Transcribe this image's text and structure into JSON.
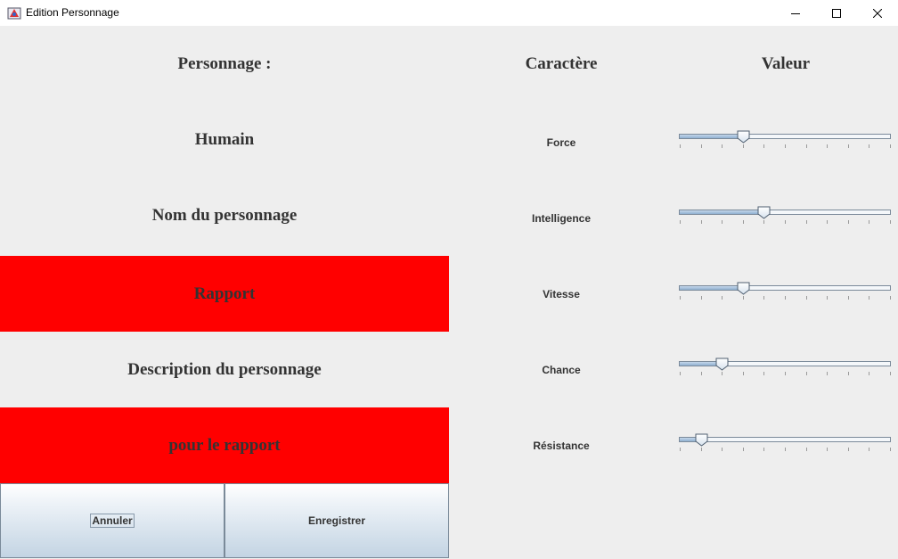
{
  "window": {
    "title": "Edition Personnage"
  },
  "left_panel": {
    "header": "Personnage :",
    "race": "Humain",
    "name_label": "Nom du personnage",
    "name_report": "Rapport",
    "description_label": "Description du personnage",
    "description_report": "pour le rapport",
    "report_color": "#ff0000"
  },
  "stats_panel": {
    "header_trait": "Caractère",
    "header_value": "Valeur",
    "traits": [
      {
        "label": "Force",
        "value": 30
      },
      {
        "label": "Intelligence",
        "value": 40
      },
      {
        "label": "Vitesse",
        "value": 30
      },
      {
        "label": "Chance",
        "value": 20
      },
      {
        "label": "Résistance",
        "value": 10
      }
    ],
    "slider_min": 0,
    "slider_max": 100,
    "tick_spacing": 10
  },
  "buttons": {
    "cancel": "Annuler",
    "save": "Enregistrer"
  }
}
